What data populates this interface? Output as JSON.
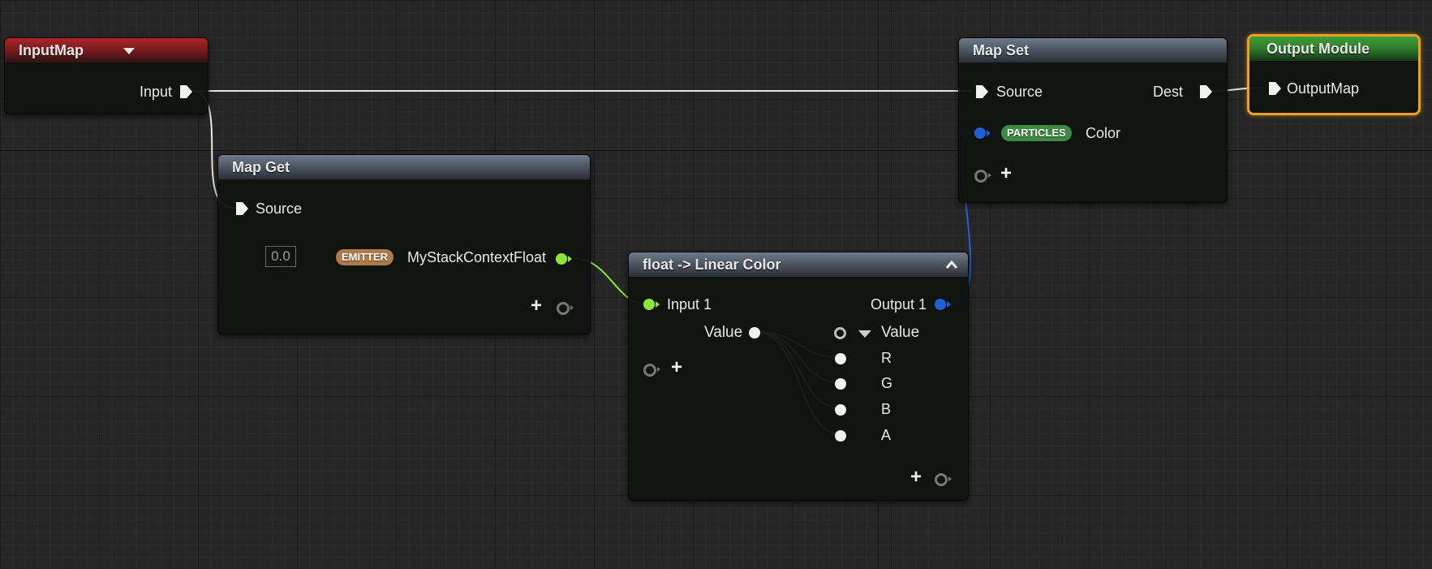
{
  "colors": {
    "background": "#262626",
    "exec_pin": "#f2f2f2",
    "float_pin": "#8ce63a",
    "color_pin": "#1f5fd1",
    "wire_white": "#e6e6e6",
    "wire_green": "#8ce63a",
    "wire_blue": "#2a5ed8",
    "badge_emitter": "#b07a4a",
    "badge_particles": "#3d8a42",
    "selection_outline": "#f0a020"
  },
  "nodes": {
    "input_map": {
      "title": "InputMap",
      "dropdown_icon": "caret-down-icon",
      "output_label": "Input"
    },
    "map_get": {
      "title": "Map Get",
      "source_label": "Source",
      "default_value": "0.0",
      "namespace_badge": "EMITTER",
      "output_label": "MyStackContextFloat",
      "add_icon": "plus-icon"
    },
    "float_to_color": {
      "title": "float -> Linear Color",
      "collapse_icon": "chevron-up-icon",
      "input_label": "Input 1",
      "output_label": "Output 1",
      "value_in_label": "Value",
      "value_out_label": "Value",
      "components": [
        "R",
        "G",
        "B",
        "A"
      ],
      "add_icon": "plus-icon"
    },
    "map_set": {
      "title": "Map Set",
      "source_label": "Source",
      "dest_label": "Dest",
      "namespace_badge": "PARTICLES",
      "param_label": "Color",
      "add_icon": "plus-icon"
    },
    "output_module": {
      "title": "Output Module",
      "input_label": "OutputMap"
    }
  }
}
